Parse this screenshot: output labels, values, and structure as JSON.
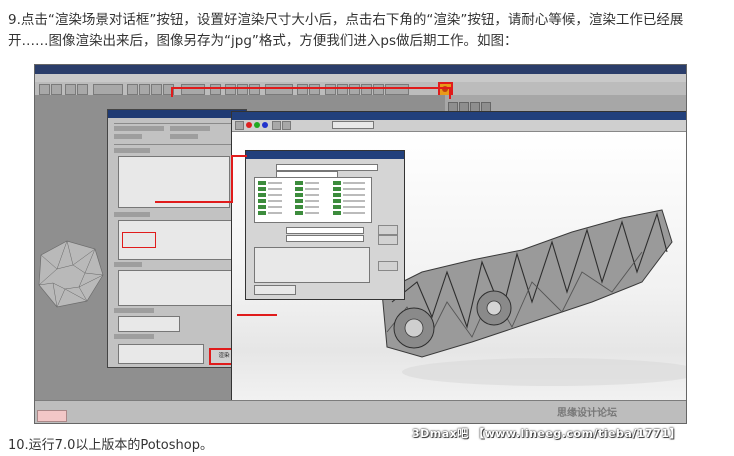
{
  "article": {
    "step9_line1": "9.点击“渲染场景对话框”按钮，设置好渲染尺寸大小后，点击右下角的“渲染”按钮，请耐心等候，渲染工作已经展",
    "step9_line2": "开……图像渲染出来后，图像另存为“jpg”格式，方便我们进入ps做后期工作。如图：",
    "step10": "10.运行7.0以上版本的Potoshop。"
  },
  "screenshot": {
    "render_button_label": "渲染",
    "watermark_site": "思缘设计论坛",
    "watermark_bottom": "3Dmax吧 【www.lineeg.com/tieba/1771】"
  },
  "colors": {
    "highlight_red": "#e01b1b",
    "titlebar_blue": "#22407c"
  }
}
